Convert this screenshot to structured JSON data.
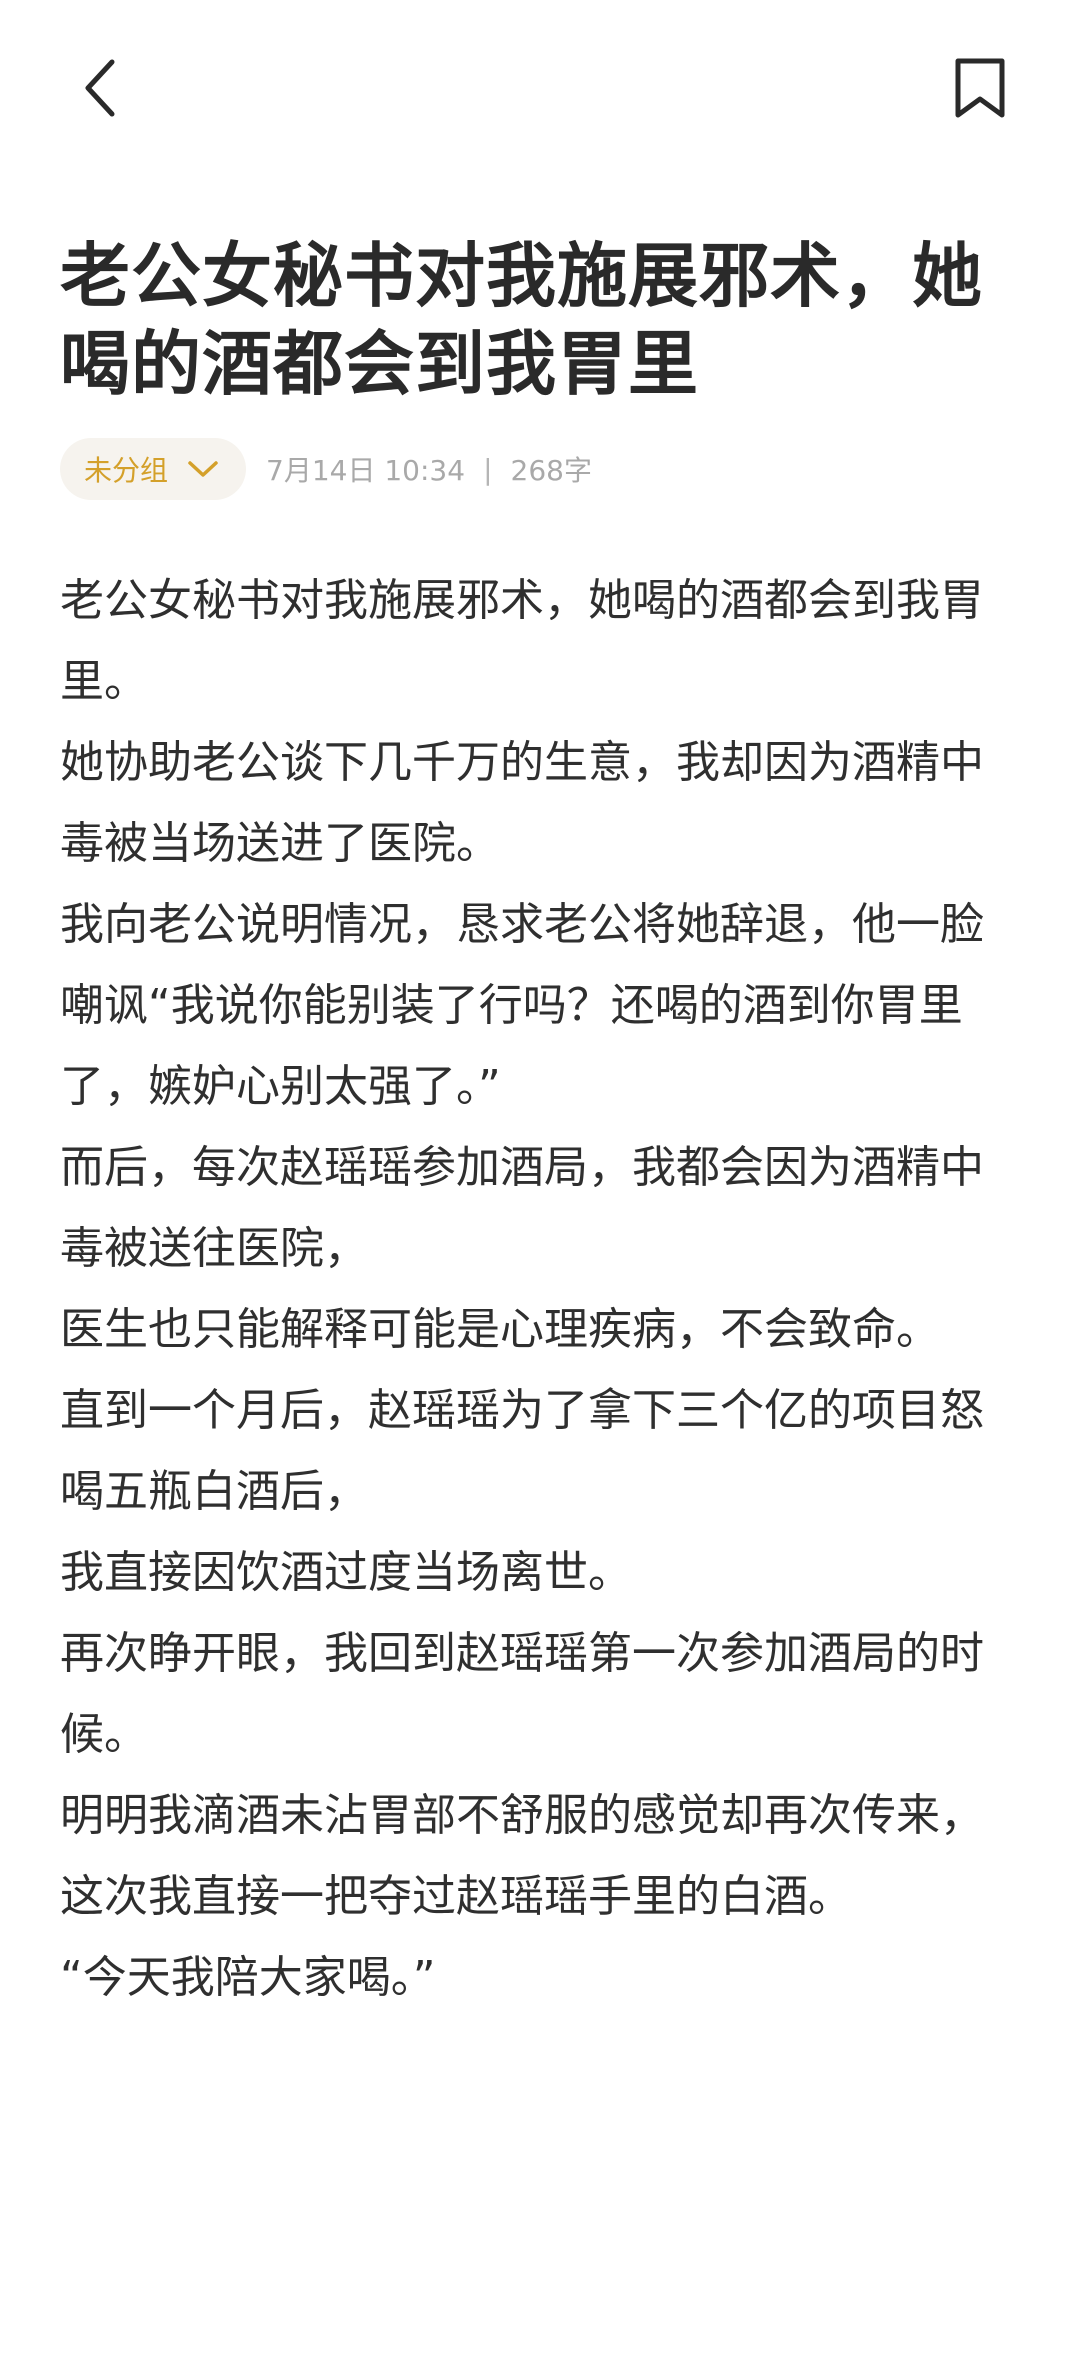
{
  "toolbar": {
    "back_icon": "chevron-left-icon",
    "bookmark_icon": "bookmark-icon"
  },
  "note": {
    "title": "老公女秘书对我施展邪术，她喝的酒都会到我胃里",
    "group_label": "未分组",
    "date": "7月14日 10:34",
    "separator": "|",
    "word_count": "268字",
    "paragraphs": [
      "老公女秘书对我施展邪术，她喝的酒都会到我胃里。",
      "她协助老公谈下几千万的生意，我却因为酒精中毒被当场送进了医院。",
      "我向老公说明情况，恳求老公将她辞退，他一脸嘲讽“我说你能别装了行吗？还喝的酒到你胃里了，嫉妒心别太强了。”",
      "而后，每次赵瑶瑶参加酒局，我都会因为酒精中毒被送往医院，",
      "医生也只能解释可能是心理疾病，不会致命。",
      "直到一个月后，赵瑶瑶为了拿下三个亿的项目怒喝五瓶白酒后，",
      "我直接因饮酒过度当场离世。",
      "再次睁开眼，我回到赵瑶瑶第一次参加酒局的时候。",
      "明明我滴酒未沾胃部不舒服的感觉却再次传来，这次我直接一把夺过赵瑶瑶手里的白酒。",
      "“今天我陪大家喝。”"
    ]
  },
  "colors": {
    "accent": "#d4a02a",
    "chip_bg": "#f6f3ee",
    "meta": "#a9a9a9",
    "text": "#2f2f2f"
  }
}
